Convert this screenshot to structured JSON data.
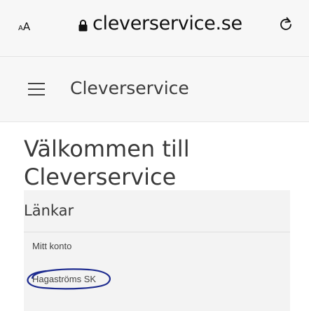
{
  "browser": {
    "aa_small": "A",
    "aa_big": "A",
    "url": "cleverservice.se"
  },
  "header": {
    "title": "Cleverservice"
  },
  "main": {
    "welcome_line1": "Välkommen till",
    "welcome_line2": "Cleverservice"
  },
  "links_widget": {
    "title": "Länkar",
    "items": [
      {
        "label": "Mitt konto"
      },
      {
        "label": "Hagaströms SK"
      }
    ]
  },
  "annotation": {
    "color": "#1d2b8f"
  },
  "icons": [
    "lock-icon",
    "reload-icon",
    "hamburger-menu-icon"
  ]
}
